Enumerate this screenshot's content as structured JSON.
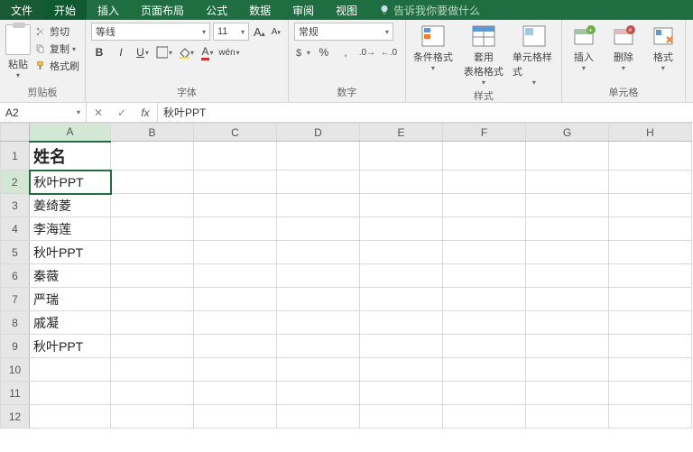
{
  "tabs": {
    "file": "文件",
    "home": "开始",
    "insert": "插入",
    "layout": "页面布局",
    "formula": "公式",
    "data": "数据",
    "review": "审阅",
    "view": "视图",
    "tell": "告诉我你要做什么"
  },
  "clipboard": {
    "paste": "粘贴",
    "cut": "剪切",
    "copy": "复制",
    "painter": "格式刷",
    "group": "剪贴板"
  },
  "font": {
    "name": "等线",
    "size": "11",
    "group": "字体"
  },
  "number": {
    "format": "常规",
    "group": "数字"
  },
  "styles": {
    "cond": "条件格式",
    "table": "套用\n表格格式",
    "cell": "单元格样式",
    "group": "样式"
  },
  "cells": {
    "insert": "插入",
    "delete": "删除",
    "format": "格式",
    "group": "单元格"
  },
  "formula": {
    "ref": "A2",
    "value": "秋叶PPT"
  },
  "columns": [
    "A",
    "B",
    "C",
    "D",
    "E",
    "F",
    "G",
    "H"
  ],
  "rows": [
    [
      "姓名",
      "",
      "",
      "",
      "",
      "",
      "",
      ""
    ],
    [
      "秋叶PPT",
      "",
      "",
      "",
      "",
      "",
      "",
      ""
    ],
    [
      "姜绮菱",
      "",
      "",
      "",
      "",
      "",
      "",
      ""
    ],
    [
      "李海莲",
      "",
      "",
      "",
      "",
      "",
      "",
      ""
    ],
    [
      "秋叶PPT",
      "",
      "",
      "",
      "",
      "",
      "",
      ""
    ],
    [
      "秦薇",
      "",
      "",
      "",
      "",
      "",
      "",
      ""
    ],
    [
      "严瑞",
      "",
      "",
      "",
      "",
      "",
      "",
      ""
    ],
    [
      "戚凝",
      "",
      "",
      "",
      "",
      "",
      "",
      ""
    ],
    [
      "秋叶PPT",
      "",
      "",
      "",
      "",
      "",
      "",
      ""
    ],
    [
      "",
      "",
      "",
      "",
      "",
      "",
      "",
      ""
    ],
    [
      "",
      "",
      "",
      "",
      "",
      "",
      "",
      ""
    ],
    [
      "",
      "",
      "",
      "",
      "",
      "",
      "",
      ""
    ]
  ],
  "selected": {
    "row": 2,
    "col": 0
  }
}
